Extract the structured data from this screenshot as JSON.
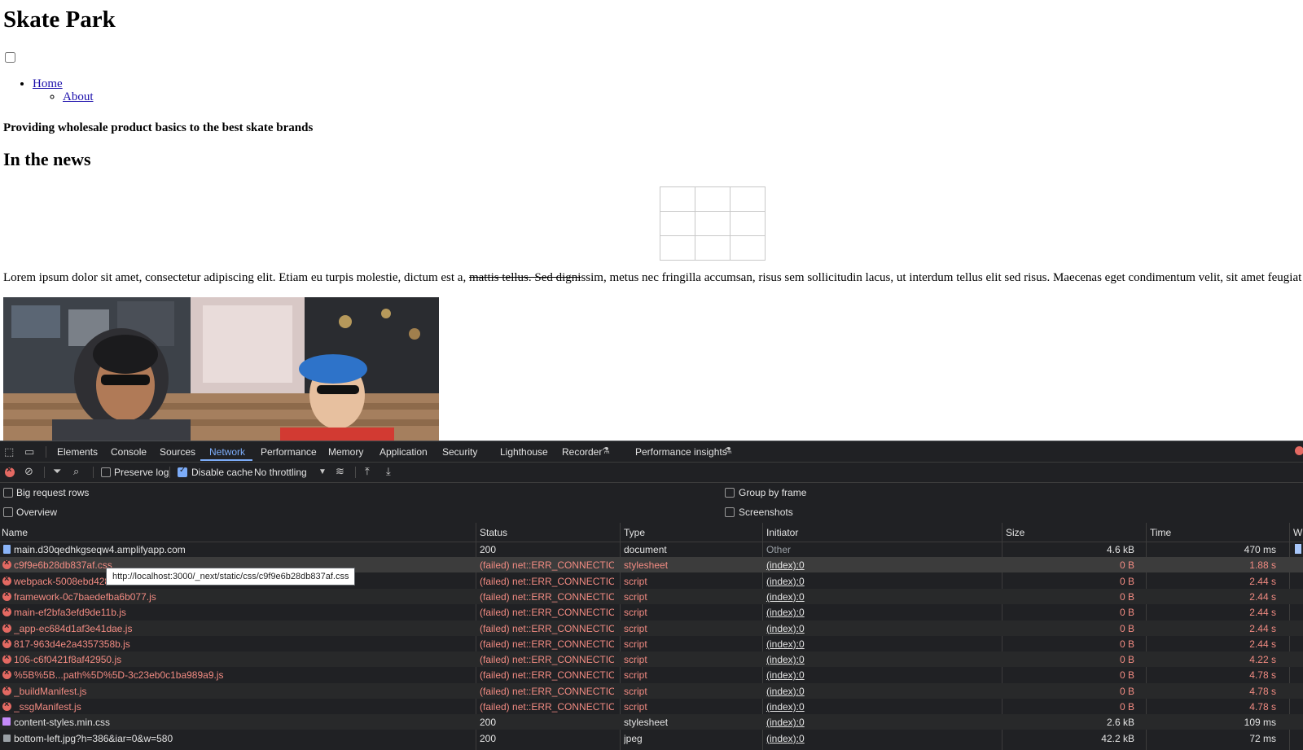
{
  "page": {
    "title": "Skate Park",
    "nav": {
      "home": "Home",
      "about": "About"
    },
    "tagline": "Providing wholesale product basics to the best skate brands",
    "news_title": "In the news",
    "lorem_before": "Lorem ipsum dolor sit amet, consectetur adipiscing elit. Etiam eu turpis molestie, dictum est a, ",
    "lorem_strike": "mattis tellus. Sed digni",
    "lorem_after": "ssim, metus nec fringilla accumsan, risus sem sollicitudin lacus, ut interdum tellus elit sed risus. Maecenas eget condimentum velit, sit amet feugiat lect"
  },
  "devtools": {
    "tabs": [
      "Elements",
      "Console",
      "Sources",
      "Network",
      "Performance",
      "Memory",
      "Application",
      "Security",
      "Lighthouse",
      "Recorder",
      "Performance insights"
    ],
    "active_tab": "Network",
    "toolbar": {
      "preserve_log": "Preserve log",
      "disable_cache": "Disable cache",
      "throttling": "No throttling"
    },
    "settings": {
      "big_request_rows": "Big request rows",
      "overview": "Overview",
      "group_by_frame": "Group by frame",
      "screenshots": "Screenshots"
    },
    "columns": {
      "name": "Name",
      "status": "Status",
      "type": "Type",
      "initiator": "Initiator",
      "size": "Size",
      "time": "Time",
      "waterfall": "W"
    },
    "tooltip": "http://localhost:3000/_next/static/css/c9f9e6b28db837af.css",
    "rows": [
      {
        "name": "main.d30qedhkgseqw4.amplifyapp.com",
        "status": "200",
        "type": "document",
        "initiator": "Other",
        "size": "4.6 kB",
        "time": "470 ms",
        "icon": "document-icon"
      },
      {
        "name": "c9f9e6b28db837af.css",
        "status": "(failed) net::ERR_CONNECTION_...",
        "type": "stylesheet",
        "initiator": "(index):0",
        "size": "0 B",
        "time": "1.88 s",
        "icon": "error-icon"
      },
      {
        "name": "webpack-5008ebd4282",
        "status": "(failed) net::ERR_CONNECTION_...",
        "type": "script",
        "initiator": "(index):0",
        "size": "0 B",
        "time": "2.44 s",
        "icon": "error-icon"
      },
      {
        "name": "framework-0c7baedefba6b077.js",
        "status": "(failed) net::ERR_CONNECTION_...",
        "type": "script",
        "initiator": "(index):0",
        "size": "0 B",
        "time": "2.44 s",
        "icon": "error-icon"
      },
      {
        "name": "main-ef2bfa3efd9de11b.js",
        "status": "(failed) net::ERR_CONNECTION_...",
        "type": "script",
        "initiator": "(index):0",
        "size": "0 B",
        "time": "2.44 s",
        "icon": "error-icon"
      },
      {
        "name": "_app-ec684d1af3e41dae.js",
        "status": "(failed) net::ERR_CONNECTION_...",
        "type": "script",
        "initiator": "(index):0",
        "size": "0 B",
        "time": "2.44 s",
        "icon": "error-icon"
      },
      {
        "name": "817-963d4e2a4357358b.js",
        "status": "(failed) net::ERR_CONNECTION_...",
        "type": "script",
        "initiator": "(index):0",
        "size": "0 B",
        "time": "2.44 s",
        "icon": "error-icon"
      },
      {
        "name": "106-c6f0421f8af42950.js",
        "status": "(failed) net::ERR_CONNECTION_...",
        "type": "script",
        "initiator": "(index):0",
        "size": "0 B",
        "time": "4.22 s",
        "icon": "error-icon"
      },
      {
        "name": "%5B%5B...path%5D%5D-3c23eb0c1ba989a9.js",
        "status": "(failed) net::ERR_CONNECTION_...",
        "type": "script",
        "initiator": "(index):0",
        "size": "0 B",
        "time": "4.78 s",
        "icon": "error-icon"
      },
      {
        "name": "_buildManifest.js",
        "status": "(failed) net::ERR_CONNECTION_...",
        "type": "script",
        "initiator": "(index):0",
        "size": "0 B",
        "time": "4.78 s",
        "icon": "error-icon"
      },
      {
        "name": "_ssgManifest.js",
        "status": "(failed) net::ERR_CONNECTION_...",
        "type": "script",
        "initiator": "(index):0",
        "size": "0 B",
        "time": "4.78 s",
        "icon": "error-icon"
      },
      {
        "name": "content-styles.min.css",
        "status": "200",
        "type": "stylesheet",
        "initiator": "(index):0",
        "size": "2.6 kB",
        "time": "109 ms",
        "icon": "stylesheet-icon"
      },
      {
        "name": "bottom-left.jpg?h=386&iar=0&w=580",
        "status": "200",
        "type": "jpeg",
        "initiator": "(index):0",
        "size": "42.2 kB",
        "time": "72 ms",
        "icon": "image-icon"
      }
    ]
  }
}
